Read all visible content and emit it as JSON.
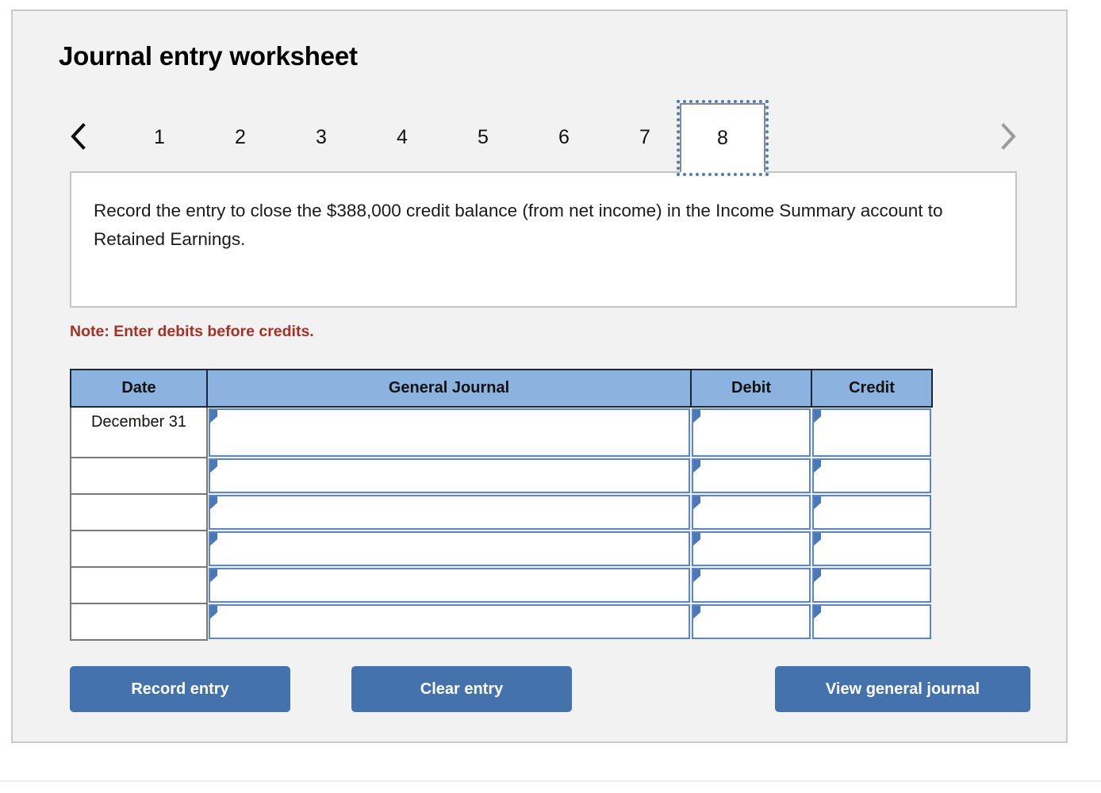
{
  "worksheet": {
    "title": "Journal entry worksheet",
    "instruction": "Record the entry to close the $388,000 credit balance (from net income) in the Income Summary account to Retained Earnings.",
    "note": "Note: Enter debits before credits."
  },
  "tabs": {
    "prev_label": "‹",
    "next_label": "›",
    "items": [
      {
        "label": "1",
        "active": false
      },
      {
        "label": "2",
        "active": false
      },
      {
        "label": "3",
        "active": false
      },
      {
        "label": "4",
        "active": false
      },
      {
        "label": "5",
        "active": false
      },
      {
        "label": "6",
        "active": false
      },
      {
        "label": "7",
        "active": false
      },
      {
        "label": "8",
        "active": true
      }
    ],
    "active_tab": "8"
  },
  "table": {
    "headers": {
      "date": "Date",
      "general_journal": "General Journal",
      "debit": "Debit",
      "credit": "Credit"
    },
    "rows": [
      {
        "date": "December 31",
        "general_journal": "",
        "debit": "",
        "credit": ""
      },
      {
        "date": "",
        "general_journal": "",
        "debit": "",
        "credit": ""
      },
      {
        "date": "",
        "general_journal": "",
        "debit": "",
        "credit": ""
      },
      {
        "date": "",
        "general_journal": "",
        "debit": "",
        "credit": ""
      },
      {
        "date": "",
        "general_journal": "",
        "debit": "",
        "credit": ""
      },
      {
        "date": "",
        "general_journal": "",
        "debit": "",
        "credit": ""
      }
    ]
  },
  "buttons": {
    "record": "Record entry",
    "clear": "Clear entry",
    "view": "View general journal"
  },
  "colors": {
    "panel_bg": "#f2f2f2",
    "header_blue": "#8cb3e0",
    "button_blue": "#4472ac",
    "note_red": "#a33224",
    "field_border_blue": "#5b86c2",
    "focus_outline": "#4a7ebb"
  }
}
